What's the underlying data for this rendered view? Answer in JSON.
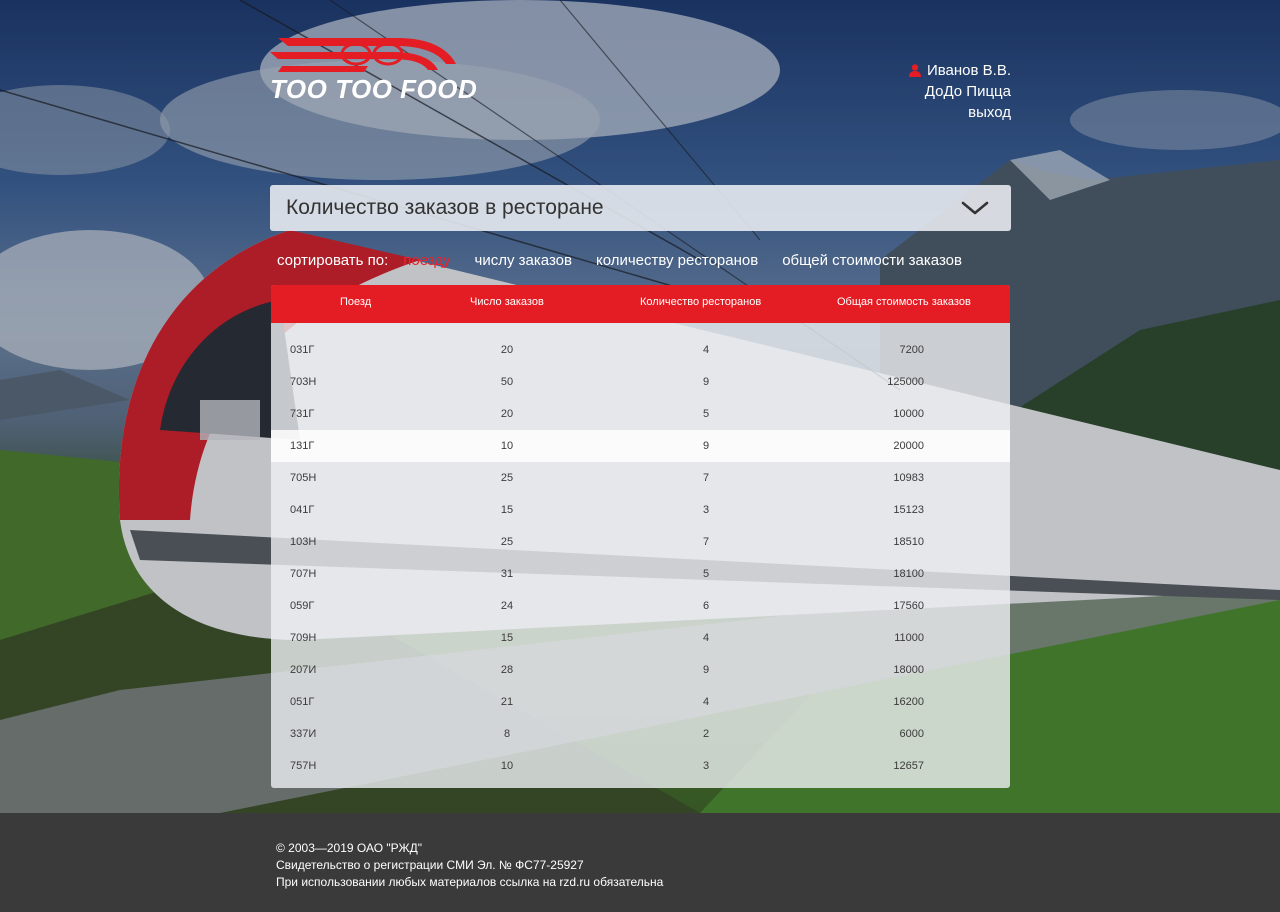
{
  "brand": {
    "name": "TOO TOO FOOD",
    "accent": "#e41d24"
  },
  "user": {
    "name": "Иванов В.В.",
    "company": "ДоДо Пицца",
    "logout": "выход",
    "icon": "user-icon"
  },
  "report": {
    "selected": "Количество заказов в ресторане",
    "icon": "chevron-down-icon"
  },
  "sort": {
    "label": "сортировать по:",
    "options": [
      {
        "label": "поезду",
        "active": true
      },
      {
        "label": "числу заказов",
        "active": false
      },
      {
        "label": "количеству ресторанов",
        "active": false
      },
      {
        "label": "общей стоимости заказов",
        "active": false
      }
    ]
  },
  "table": {
    "headers": [
      "Поезд",
      "Число заказов",
      "Количество ресторанов",
      "Общая стоимость заказов"
    ],
    "rows": [
      {
        "train": "031Г",
        "orders": "20",
        "restaurants": "4",
        "total": "7200"
      },
      {
        "train": "703Н",
        "orders": "50",
        "restaurants": "9",
        "total": "125000"
      },
      {
        "train": "731Г",
        "orders": "20",
        "restaurants": "5",
        "total": "10000"
      },
      {
        "train": "131Г",
        "orders": "10",
        "restaurants": "9",
        "total": "20000",
        "highlighted": true
      },
      {
        "train": "705Н",
        "orders": "25",
        "restaurants": "7",
        "total": "10983"
      },
      {
        "train": "041Г",
        "orders": "15",
        "restaurants": "3",
        "total": "15123"
      },
      {
        "train": "103Н",
        "orders": "25",
        "restaurants": "7",
        "total": "18510"
      },
      {
        "train": "707Н",
        "orders": "31",
        "restaurants": "5",
        "total": "18100"
      },
      {
        "train": "059Г",
        "orders": "24",
        "restaurants": "6",
        "total": "17560"
      },
      {
        "train": "709Н",
        "orders": "15",
        "restaurants": "4",
        "total": "11000"
      },
      {
        "train": "207И",
        "orders": "28",
        "restaurants": "9",
        "total": "18000"
      },
      {
        "train": "051Г",
        "orders": "21",
        "restaurants": "4",
        "total": "16200"
      },
      {
        "train": "337И",
        "orders": "8",
        "restaurants": "2",
        "total": "6000"
      },
      {
        "train": "757Н",
        "orders": "10",
        "restaurants": "3",
        "total": "12657"
      }
    ]
  },
  "footer": {
    "lines": [
      "© 2003—2019  ОАО \"РЖД\"",
      "Свидетельство о регистрации СМИ Эл. № ФС77-25927",
      "При использовании любых материалов ссылка на rzd.ru обязательна"
    ]
  }
}
